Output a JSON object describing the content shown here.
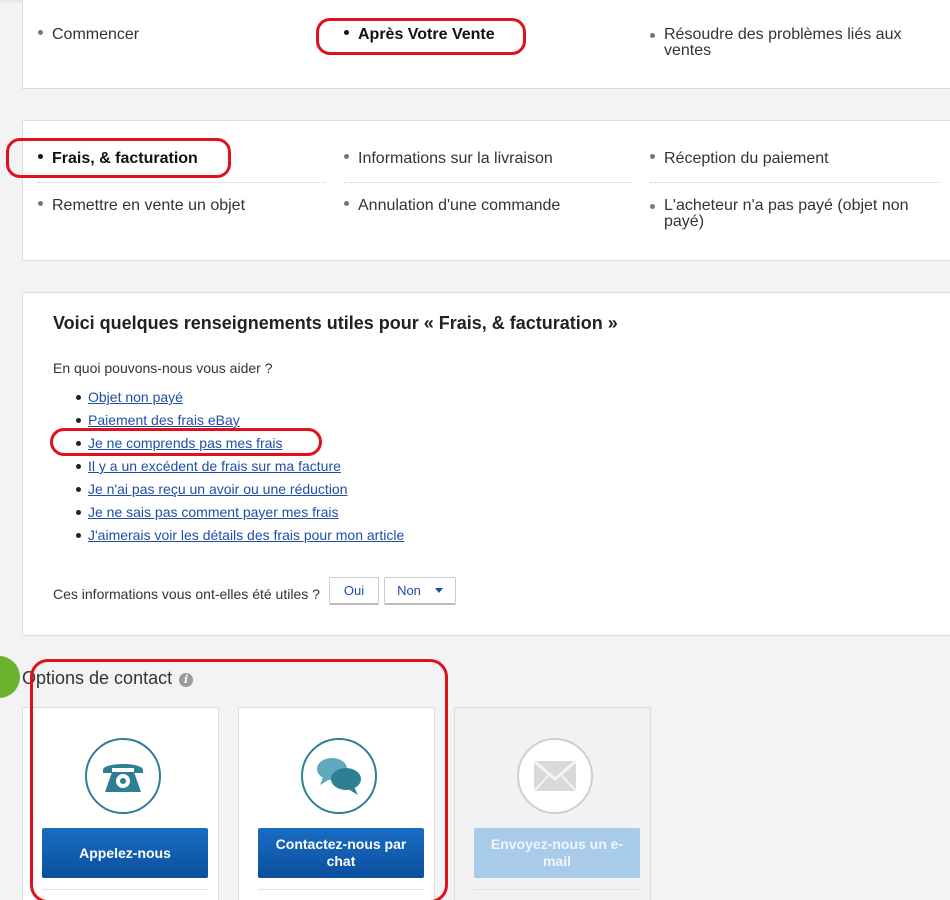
{
  "top_nav": {
    "items": [
      {
        "label": "Commencer",
        "bold": false
      },
      {
        "label": "Après Votre Vente",
        "bold": true
      },
      {
        "label": "Résoudre des problèmes liés aux ventes",
        "bold": false
      }
    ]
  },
  "sub_nav": {
    "items": [
      {
        "label": "Frais, & facturation",
        "bold": true
      },
      {
        "label": "Informations sur la livraison",
        "bold": false
      },
      {
        "label": "Réception du paiement",
        "bold": false
      },
      {
        "label": "Remettre en vente un objet",
        "bold": false
      },
      {
        "label": "Annulation d'une commande",
        "bold": false
      },
      {
        "label": "L'acheteur n'a pas payé (objet non payé)",
        "bold": false
      }
    ]
  },
  "info": {
    "title": "Voici quelques renseignements utiles pour « Frais, & facturation »",
    "question": "En quoi pouvons-nous vous aider ?",
    "links": [
      "Objet non payé",
      "Paiement des frais eBay",
      "Je ne comprends pas mes frais",
      "Il y a un excédent de frais sur ma facture",
      "Je n'ai pas reçu un avoir ou une réduction",
      "Je ne sais pas comment payer mes frais",
      "J'aimerais voir les détails des frais pour mon article"
    ],
    "feedback_question": "Ces informations vous ont-elles été utiles ?",
    "yes_label": "Oui",
    "no_label": "Non"
  },
  "contact": {
    "title": "Options de contact",
    "info_icon": "i",
    "cards": [
      {
        "label": "Appelez-nous",
        "icon": "phone-icon",
        "enabled": true
      },
      {
        "label": "Contactez-nous par chat",
        "icon": "chat-bubbles-icon",
        "enabled": true
      },
      {
        "label": "Envoyez-nous un e-mail",
        "icon": "envelope-icon",
        "enabled": false
      }
    ]
  },
  "colors": {
    "link": "#1f4ea8",
    "annotation_red": "#e0101c",
    "primary_button": "#0b4f9e",
    "icon_teal": "#2e7f94",
    "green_accent": "#6ab42d"
  }
}
